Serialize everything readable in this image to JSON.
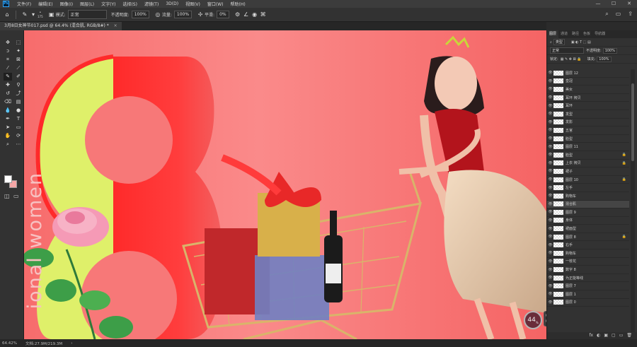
{
  "menubar": {
    "logo": "Ps",
    "items": [
      "文件(F)",
      "编辑(E)",
      "图像(I)",
      "图层(L)",
      "文字(Y)",
      "选择(S)",
      "滤镜(T)",
      "3D(D)",
      "视图(V)",
      "窗口(W)",
      "帮助(H)"
    ],
    "window_controls": [
      "—",
      "☐",
      "✕"
    ]
  },
  "options": {
    "brush_size": "175",
    "mode_label": "模式:",
    "mode_value": "正常",
    "opacity_label": "不透明度:",
    "opacity_value": "100%",
    "flow_label": "流量:",
    "flow_value": "100%",
    "smooth_label": "平滑:",
    "smooth_value": "0%"
  },
  "document": {
    "tab_title": "3月8日女神节017.psd @ 64.4% (混合肌, RGB/8#) *",
    "tab_close": "×"
  },
  "canvas": {
    "vertical_text": "ional women",
    "zoom_bubble": "44",
    "zoom_bubble_unit": "%",
    "hud_line1": "0",
    "hud_line2": "0"
  },
  "panel": {
    "tabs": [
      "图层",
      "通道",
      "路径",
      "色板",
      "导航器"
    ],
    "active_tab": "图层",
    "filter_label": "类型",
    "blend_mode": "正常",
    "opacity_label": "不透明度:",
    "opacity_value": "100%",
    "lock_label": "锁定:",
    "fill_label": "填充:",
    "fill_value": "100%",
    "layers": [
      {
        "name": "图层 12",
        "lock": false,
        "selected": false
      },
      {
        "name": "皇冠",
        "lock": false,
        "selected": false
      },
      {
        "name": "美女",
        "lock": false,
        "selected": false
      },
      {
        "name": "耳环 拷贝",
        "lock": false,
        "selected": false
      },
      {
        "name": "耳环",
        "lock": false,
        "selected": false
      },
      {
        "name": "发型",
        "lock": false,
        "selected": false
      },
      {
        "name": "发影",
        "lock": false,
        "selected": false
      },
      {
        "name": "五官",
        "lock": false,
        "selected": false
      },
      {
        "name": "脸型",
        "lock": false,
        "selected": false
      },
      {
        "name": "图层 11",
        "lock": false,
        "selected": false
      },
      {
        "name": "脸型",
        "lock": true,
        "selected": false
      },
      {
        "name": "上衣 拷贝",
        "lock": true,
        "selected": false
      },
      {
        "name": "裙子",
        "lock": false,
        "selected": false
      },
      {
        "name": "图层 10",
        "lock": true,
        "selected": false
      },
      {
        "name": "左手",
        "lock": false,
        "selected": false
      },
      {
        "name": "购物车",
        "lock": false,
        "selected": false
      },
      {
        "name": "混合肌",
        "lock": false,
        "selected": true
      },
      {
        "name": "图层 9",
        "lock": false,
        "selected": false
      },
      {
        "name": "身体",
        "lock": false,
        "selected": false
      },
      {
        "name": "裙面型",
        "lock": false,
        "selected": false
      },
      {
        "name": "图层 8",
        "lock": true,
        "selected": false
      },
      {
        "name": "右手",
        "lock": false,
        "selected": false
      },
      {
        "name": "购物车",
        "lock": false,
        "selected": false
      },
      {
        "name": "一枝花",
        "lock": false,
        "selected": false
      },
      {
        "name": "数字 8",
        "lock": false,
        "selected": false
      },
      {
        "name": "为正能等线",
        "lock": false,
        "selected": false
      },
      {
        "name": "图层 7",
        "lock": false,
        "selected": false
      },
      {
        "name": "图层 1",
        "lock": false,
        "selected": false
      },
      {
        "name": "图层 0",
        "lock": false,
        "selected": false
      }
    ],
    "footer_icons": [
      "fx",
      "◐",
      "▣",
      "▢",
      "▭",
      "🗑"
    ]
  },
  "status": {
    "zoom": "64.42%",
    "doc_size": "文档:27.9M/219.3M"
  }
}
